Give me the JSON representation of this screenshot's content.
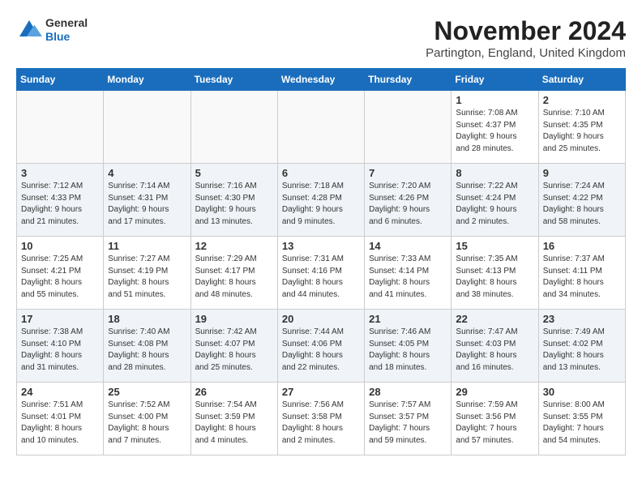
{
  "logo": {
    "general": "General",
    "blue": "Blue"
  },
  "header": {
    "month": "November 2024",
    "location": "Partington, England, United Kingdom"
  },
  "weekdays": [
    "Sunday",
    "Monday",
    "Tuesday",
    "Wednesday",
    "Thursday",
    "Friday",
    "Saturday"
  ],
  "weeks": [
    [
      {
        "day": "",
        "info": ""
      },
      {
        "day": "",
        "info": ""
      },
      {
        "day": "",
        "info": ""
      },
      {
        "day": "",
        "info": ""
      },
      {
        "day": "",
        "info": ""
      },
      {
        "day": "1",
        "info": "Sunrise: 7:08 AM\nSunset: 4:37 PM\nDaylight: 9 hours\nand 28 minutes."
      },
      {
        "day": "2",
        "info": "Sunrise: 7:10 AM\nSunset: 4:35 PM\nDaylight: 9 hours\nand 25 minutes."
      }
    ],
    [
      {
        "day": "3",
        "info": "Sunrise: 7:12 AM\nSunset: 4:33 PM\nDaylight: 9 hours\nand 21 minutes."
      },
      {
        "day": "4",
        "info": "Sunrise: 7:14 AM\nSunset: 4:31 PM\nDaylight: 9 hours\nand 17 minutes."
      },
      {
        "day": "5",
        "info": "Sunrise: 7:16 AM\nSunset: 4:30 PM\nDaylight: 9 hours\nand 13 minutes."
      },
      {
        "day": "6",
        "info": "Sunrise: 7:18 AM\nSunset: 4:28 PM\nDaylight: 9 hours\nand 9 minutes."
      },
      {
        "day": "7",
        "info": "Sunrise: 7:20 AM\nSunset: 4:26 PM\nDaylight: 9 hours\nand 6 minutes."
      },
      {
        "day": "8",
        "info": "Sunrise: 7:22 AM\nSunset: 4:24 PM\nDaylight: 9 hours\nand 2 minutes."
      },
      {
        "day": "9",
        "info": "Sunrise: 7:24 AM\nSunset: 4:22 PM\nDaylight: 8 hours\nand 58 minutes."
      }
    ],
    [
      {
        "day": "10",
        "info": "Sunrise: 7:25 AM\nSunset: 4:21 PM\nDaylight: 8 hours\nand 55 minutes."
      },
      {
        "day": "11",
        "info": "Sunrise: 7:27 AM\nSunset: 4:19 PM\nDaylight: 8 hours\nand 51 minutes."
      },
      {
        "day": "12",
        "info": "Sunrise: 7:29 AM\nSunset: 4:17 PM\nDaylight: 8 hours\nand 48 minutes."
      },
      {
        "day": "13",
        "info": "Sunrise: 7:31 AM\nSunset: 4:16 PM\nDaylight: 8 hours\nand 44 minutes."
      },
      {
        "day": "14",
        "info": "Sunrise: 7:33 AM\nSunset: 4:14 PM\nDaylight: 8 hours\nand 41 minutes."
      },
      {
        "day": "15",
        "info": "Sunrise: 7:35 AM\nSunset: 4:13 PM\nDaylight: 8 hours\nand 38 minutes."
      },
      {
        "day": "16",
        "info": "Sunrise: 7:37 AM\nSunset: 4:11 PM\nDaylight: 8 hours\nand 34 minutes."
      }
    ],
    [
      {
        "day": "17",
        "info": "Sunrise: 7:38 AM\nSunset: 4:10 PM\nDaylight: 8 hours\nand 31 minutes."
      },
      {
        "day": "18",
        "info": "Sunrise: 7:40 AM\nSunset: 4:08 PM\nDaylight: 8 hours\nand 28 minutes."
      },
      {
        "day": "19",
        "info": "Sunrise: 7:42 AM\nSunset: 4:07 PM\nDaylight: 8 hours\nand 25 minutes."
      },
      {
        "day": "20",
        "info": "Sunrise: 7:44 AM\nSunset: 4:06 PM\nDaylight: 8 hours\nand 22 minutes."
      },
      {
        "day": "21",
        "info": "Sunrise: 7:46 AM\nSunset: 4:05 PM\nDaylight: 8 hours\nand 18 minutes."
      },
      {
        "day": "22",
        "info": "Sunrise: 7:47 AM\nSunset: 4:03 PM\nDaylight: 8 hours\nand 16 minutes."
      },
      {
        "day": "23",
        "info": "Sunrise: 7:49 AM\nSunset: 4:02 PM\nDaylight: 8 hours\nand 13 minutes."
      }
    ],
    [
      {
        "day": "24",
        "info": "Sunrise: 7:51 AM\nSunset: 4:01 PM\nDaylight: 8 hours\nand 10 minutes."
      },
      {
        "day": "25",
        "info": "Sunrise: 7:52 AM\nSunset: 4:00 PM\nDaylight: 8 hours\nand 7 minutes."
      },
      {
        "day": "26",
        "info": "Sunrise: 7:54 AM\nSunset: 3:59 PM\nDaylight: 8 hours\nand 4 minutes."
      },
      {
        "day": "27",
        "info": "Sunrise: 7:56 AM\nSunset: 3:58 PM\nDaylight: 8 hours\nand 2 minutes."
      },
      {
        "day": "28",
        "info": "Sunrise: 7:57 AM\nSunset: 3:57 PM\nDaylight: 7 hours\nand 59 minutes."
      },
      {
        "day": "29",
        "info": "Sunrise: 7:59 AM\nSunset: 3:56 PM\nDaylight: 7 hours\nand 57 minutes."
      },
      {
        "day": "30",
        "info": "Sunrise: 8:00 AM\nSunset: 3:55 PM\nDaylight: 7 hours\nand 54 minutes."
      }
    ]
  ]
}
